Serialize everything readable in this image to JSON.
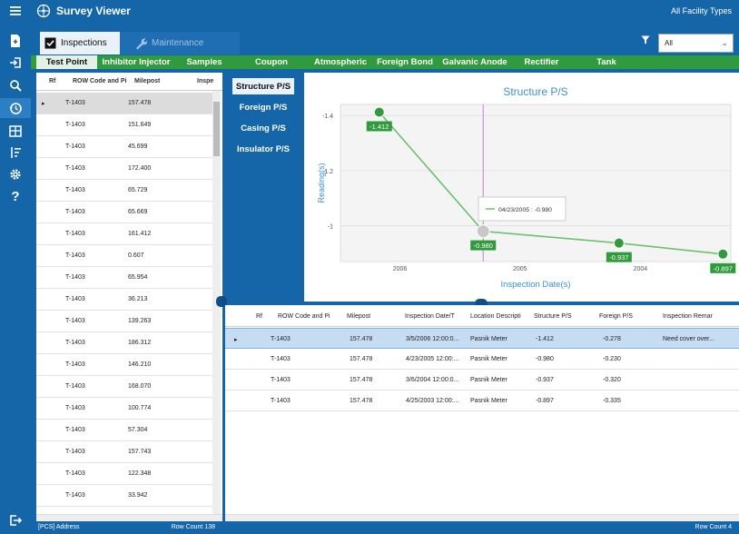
{
  "app": {
    "title": "Survey Viewer",
    "facility_filter": "All Facility Types"
  },
  "main_tabs": [
    {
      "label": "Inspections"
    },
    {
      "label": "Maintenance"
    }
  ],
  "filter": {
    "value": "All"
  },
  "categories": [
    "Test Point",
    "Inhibitor Injector",
    "Samples",
    "Coupon",
    "Atmospheric",
    "Foreign Bond",
    "Galvanic Anode",
    "Rectifier",
    "Tank"
  ],
  "left_grid": {
    "headers": [
      "Rf",
      "ROW Code and Pi",
      "Milepost",
      "Inspe"
    ],
    "rows": [
      {
        "code": "T-1403",
        "milepost": "157.478"
      },
      {
        "code": "T-1403",
        "milepost": "151.649"
      },
      {
        "code": "T-1403",
        "milepost": "45.699"
      },
      {
        "code": "T-1403",
        "milepost": "172.400"
      },
      {
        "code": "T-1403",
        "milepost": "65.729"
      },
      {
        "code": "T-1403",
        "milepost": "65.669"
      },
      {
        "code": "T-1403",
        "milepost": "161.412"
      },
      {
        "code": "T-1403",
        "milepost": "0.607"
      },
      {
        "code": "T-1403",
        "milepost": "65.954"
      },
      {
        "code": "T-1403",
        "milepost": "36.213"
      },
      {
        "code": "T-1403",
        "milepost": "139.263"
      },
      {
        "code": "T-1403",
        "milepost": "186.312"
      },
      {
        "code": "T-1403",
        "milepost": "146.210"
      },
      {
        "code": "T-1403",
        "milepost": "168.070"
      },
      {
        "code": "T-1403",
        "milepost": "100.774"
      },
      {
        "code": "T-1403",
        "milepost": "57.304"
      },
      {
        "code": "T-1403",
        "milepost": "157.743"
      },
      {
        "code": "T-1403",
        "milepost": "122.348"
      },
      {
        "code": "T-1403",
        "milepost": "33.942"
      }
    ],
    "status_left": "[PCS] Address",
    "status_right": "Row Count 138"
  },
  "reading_tabs": [
    "Structure P/S",
    "Foreign P/S",
    "Casing P/S",
    "Insulator P/S"
  ],
  "chart_data": {
    "type": "line",
    "title": "Structure P/S",
    "xlabel": "Inspection Date(s)",
    "ylabel": "Reading(s)",
    "x_ticks": [
      "2006",
      "2005",
      "2004"
    ],
    "y_ticks": [
      "-1.4",
      "-1.2",
      "-1"
    ],
    "y_reversed": true,
    "ylim": [
      -0.87,
      -1.44
    ],
    "points": [
      {
        "date": "3/5/2006",
        "value": -1.412,
        "label": "-1.412"
      },
      {
        "date": "4/23/2005",
        "value": -0.98,
        "label": "-0.980"
      },
      {
        "date": "3/6/2004",
        "value": -0.937,
        "label": "-0.937"
      },
      {
        "date": "4/25/2003",
        "value": -0.897,
        "label": "-0.897"
      }
    ],
    "tooltip": "04/23/2005 : -0.980",
    "line_color": "#6cc16e",
    "marker_color": "#2f9b3c"
  },
  "detail_grid": {
    "headers": [
      "Rf",
      "ROW Code and Pi",
      "Milepost",
      "Inspection Date/T",
      "Location Descripti",
      "Structure P/S",
      "Foreign P/S",
      "Inspection Remar"
    ],
    "rows": [
      {
        "code": "T-1403",
        "milepost": "157.478",
        "date": "3/5/2006 12:00:0...",
        "location": "Pasnik Meter",
        "structure": "-1.412",
        "foreign": "-0.278",
        "remark": "Need cover over..."
      },
      {
        "code": "T-1403",
        "milepost": "157.478",
        "date": "4/23/2005 12:00:...",
        "location": "Pasnik Meter",
        "structure": "-0.980",
        "foreign": "-0.230",
        "remark": ""
      },
      {
        "code": "T-1403",
        "milepost": "157.478",
        "date": "3/6/2004 12:00:0...",
        "location": "Pasnik Meter",
        "structure": "-0.937",
        "foreign": "-0.320",
        "remark": ""
      },
      {
        "code": "T-1403",
        "milepost": "157.478",
        "date": "4/25/2003 12:00:...",
        "location": "Pasnik Meter",
        "structure": "-0.897",
        "foreign": "-0.335",
        "remark": ""
      }
    ],
    "status_right": "Row Count 4"
  },
  "icons": [
    "menu-icon",
    "new-document-icon",
    "login-icon",
    "search-icon",
    "history-icon",
    "table-icon",
    "sort-icon",
    "settings-icon",
    "help-icon",
    "logout-icon",
    "filter-icon"
  ]
}
